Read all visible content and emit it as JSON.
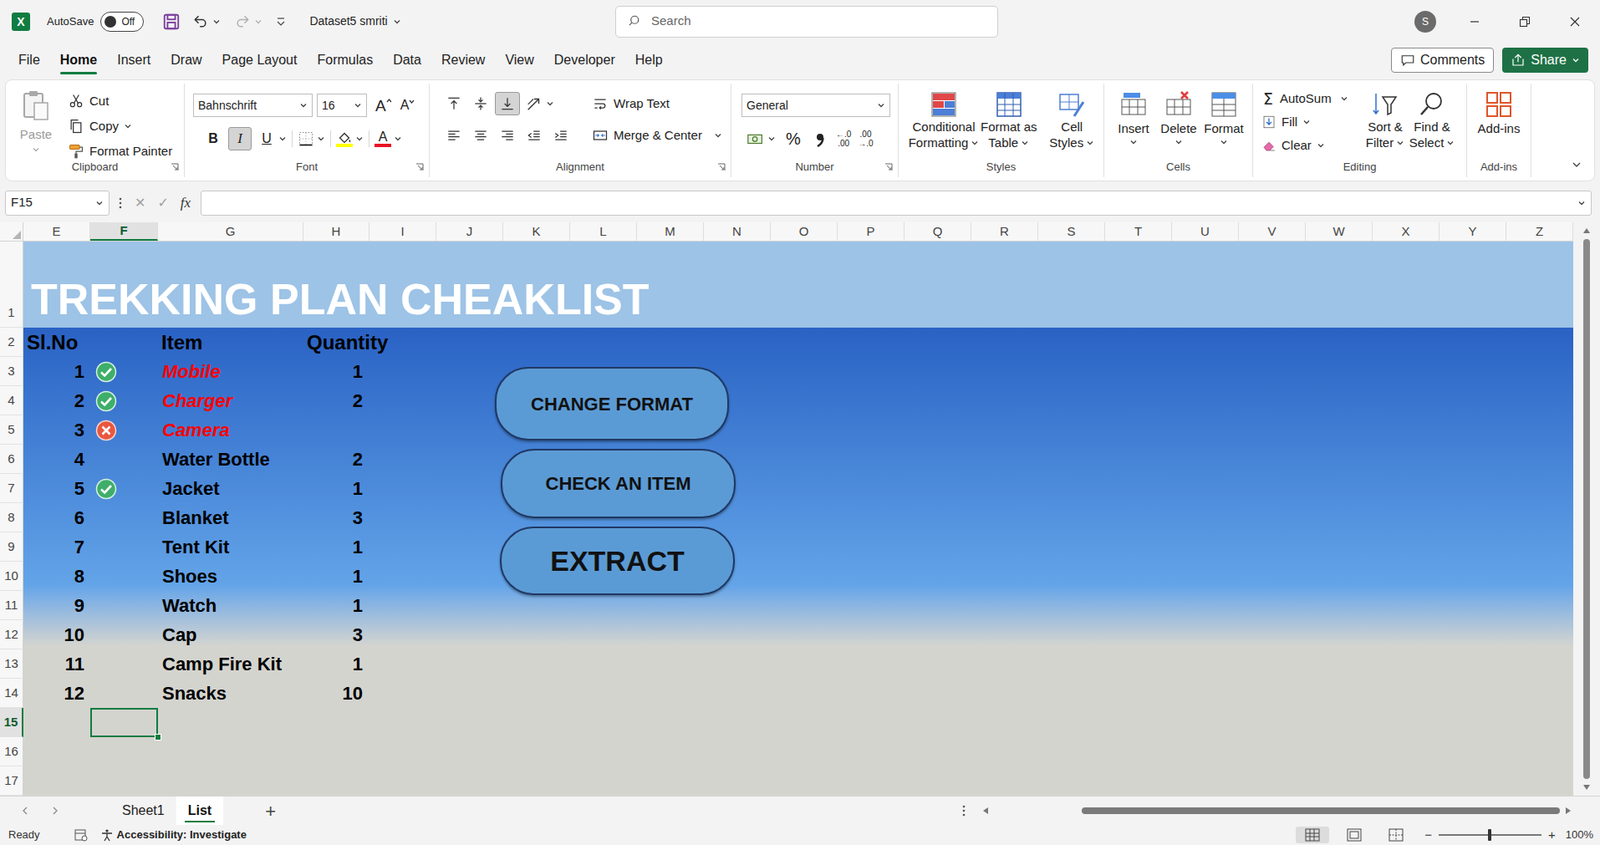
{
  "window": {
    "app_icon": "X",
    "autosave_label": "AutoSave",
    "autosave": {
      "label": "Off",
      "on": false
    },
    "title": "Dataset5 smriti",
    "search_placeholder": "Search",
    "avatar": "S"
  },
  "menu": [
    {
      "label": "File",
      "selected": false
    },
    {
      "label": "Home",
      "selected": true
    },
    {
      "label": "Insert",
      "selected": false
    },
    {
      "label": "Draw",
      "selected": false
    },
    {
      "label": "Page Layout",
      "selected": false
    },
    {
      "label": "Formulas",
      "selected": false
    },
    {
      "label": "Data",
      "selected": false
    },
    {
      "label": "Review",
      "selected": false
    },
    {
      "label": "View",
      "selected": false
    },
    {
      "label": "Developer",
      "selected": false
    },
    {
      "label": "Help",
      "selected": false
    }
  ],
  "actions": {
    "comments": "Comments",
    "share": "Share"
  },
  "ribbon": {
    "clipboard": {
      "label": "Clipboard",
      "paste": {
        "label": "Paste",
        "disabled": true
      },
      "cut": "Cut",
      "copy": "Copy",
      "format_painter": "Format Painter"
    },
    "font": {
      "label": "Font",
      "family": "Bahnschrift",
      "size": "16",
      "grow": "A",
      "shrink": "A",
      "bold": {
        "label": "B",
        "selected": false
      },
      "italic": {
        "label": "I",
        "selected": true
      },
      "underline": {
        "label": "U",
        "selected": false
      },
      "fill_color": "#ffff00",
      "font_color": {
        "label": "A",
        "color": "#e81123"
      }
    },
    "alignment": {
      "label": "Alignment",
      "vertical": [
        {
          "kind": "top",
          "selected": false
        },
        {
          "kind": "middle",
          "selected": false
        },
        {
          "kind": "bottom",
          "selected": true
        }
      ],
      "wrap_text": "Wrap Text",
      "merge_center": "Merge & Center"
    },
    "number": {
      "label": "Number",
      "format": "General",
      "percent": "%",
      "increase_decimal": {
        "top": "←.0",
        "bottom": ".00"
      },
      "decrease_decimal": {
        "top": ".00",
        "bottom": "→.0"
      }
    },
    "styles": {
      "label": "Styles",
      "buttons": [
        {
          "lines": [
            "Conditional",
            "Formatting"
          ]
        },
        {
          "lines": [
            "Format as",
            "Table"
          ]
        },
        {
          "lines": [
            "Cell",
            "Styles"
          ]
        }
      ]
    },
    "cells": {
      "label": "Cells",
      "buttons": [
        "Insert",
        "Delete",
        "Format"
      ]
    },
    "editing": {
      "label": "Editing",
      "autosum_icon": "Σ",
      "autosum": "AutoSum",
      "fill": "Fill",
      "clear": "Clear",
      "sort_filter": [
        "Sort &",
        "Filter"
      ],
      "find_select": [
        "Find &",
        "Select"
      ]
    },
    "addins": {
      "label": "Add-ins",
      "button": "Add-ins"
    }
  },
  "formula_bar": {
    "name_box": "F15",
    "cancel": "✕",
    "enter": "✓",
    "fx": "fx",
    "content": ""
  },
  "sheet": {
    "columns": [
      {
        "label": "E",
        "selected": false
      },
      {
        "label": "F",
        "selected": true
      },
      {
        "label": "G",
        "selected": false
      },
      {
        "label": "H",
        "selected": false
      },
      {
        "label": "I",
        "selected": false
      },
      {
        "label": "J",
        "selected": false
      },
      {
        "label": "K",
        "selected": false
      },
      {
        "label": "L",
        "selected": false
      },
      {
        "label": "M",
        "selected": false
      },
      {
        "label": "N",
        "selected": false
      },
      {
        "label": "O",
        "selected": false
      },
      {
        "label": "P",
        "selected": false
      },
      {
        "label": "Q",
        "selected": false
      },
      {
        "label": "R",
        "selected": false
      },
      {
        "label": "S",
        "selected": false
      },
      {
        "label": "T",
        "selected": false
      },
      {
        "label": "U",
        "selected": false
      },
      {
        "label": "V",
        "selected": false
      },
      {
        "label": "W",
        "selected": false
      },
      {
        "label": "X",
        "selected": false
      },
      {
        "label": "Y",
        "selected": false
      },
      {
        "label": "Z",
        "selected": false
      }
    ],
    "rows": [
      {
        "label": "1",
        "selected": false
      },
      {
        "label": "2",
        "selected": false
      },
      {
        "label": "3",
        "selected": false
      },
      {
        "label": "4",
        "selected": false
      },
      {
        "label": "5",
        "selected": false
      },
      {
        "label": "6",
        "selected": false
      },
      {
        "label": "7",
        "selected": false
      },
      {
        "label": "8",
        "selected": false
      },
      {
        "label": "9",
        "selected": false
      },
      {
        "label": "10",
        "selected": false
      },
      {
        "label": "11",
        "selected": false
      },
      {
        "label": "12",
        "selected": false
      },
      {
        "label": "13",
        "selected": false
      },
      {
        "label": "14",
        "selected": false
      },
      {
        "label": "15",
        "selected": true
      },
      {
        "label": "16",
        "selected": false
      },
      {
        "label": "17",
        "selected": false
      }
    ],
    "title": "TREKKING PLAN CHEAKLIST",
    "headers": [
      "Sl.No",
      "Item",
      "Quantity"
    ],
    "items": [
      {
        "no": "1",
        "kind": "check",
        "item": "Mobile",
        "quantity": "1",
        "flagged": true
      },
      {
        "no": "2",
        "kind": "check",
        "item": "Charger",
        "quantity": "2",
        "flagged": true
      },
      {
        "no": "3",
        "kind": "cross",
        "item": "Camera",
        "quantity": "",
        "flagged": true
      },
      {
        "no": "4",
        "kind": "none",
        "item": "Water Bottle",
        "quantity": "2",
        "flagged": false
      },
      {
        "no": "5",
        "kind": "check",
        "item": "Jacket",
        "quantity": "1",
        "flagged": false
      },
      {
        "no": "6",
        "kind": "none",
        "item": "Blanket",
        "quantity": "3",
        "flagged": false
      },
      {
        "no": "7",
        "kind": "none",
        "item": "Tent Kit",
        "quantity": "1",
        "flagged": false
      },
      {
        "no": "8",
        "kind": "none",
        "item": "Shoes",
        "quantity": "1",
        "flagged": false
      },
      {
        "no": "9",
        "kind": "none",
        "item": "Watch",
        "quantity": "1",
        "flagged": false
      },
      {
        "no": "10",
        "kind": "none",
        "item": "Cap",
        "quantity": "3",
        "flagged": false
      },
      {
        "no": "11",
        "kind": "none",
        "item": "Camp Fire Kit",
        "quantity": "1",
        "flagged": false
      },
      {
        "no": "12",
        "kind": "none",
        "item": "Snacks",
        "quantity": "10",
        "flagged": false
      }
    ],
    "selected_cell": {
      "column": "F",
      "row": "15"
    },
    "shapes": [
      "CHANGE FORMAT",
      "CHECK AN ITEM",
      "EXTRACT"
    ]
  },
  "sheet_tabs": {
    "tabs": [
      {
        "label": "Sheet1",
        "selected": false
      },
      {
        "label": "List",
        "selected": true
      }
    ],
    "add": "+"
  },
  "status_bar": {
    "mode": "Ready",
    "accessibility": "Accessibility: Investigate",
    "views": [
      {
        "kind": "normal",
        "selected": true
      },
      {
        "kind": "page-layout",
        "selected": false
      },
      {
        "kind": "page-break",
        "selected": false
      }
    ],
    "zoom_out": "−",
    "zoom_in": "+",
    "zoom_level": 0.5,
    "zoom": "100%"
  }
}
